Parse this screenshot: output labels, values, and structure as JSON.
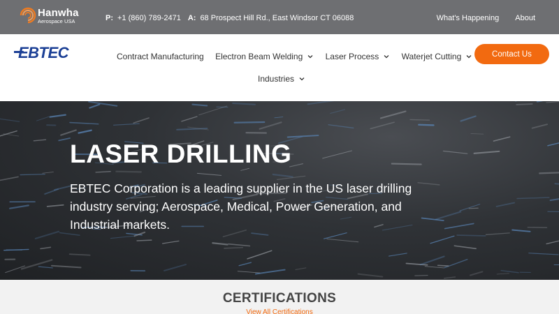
{
  "topbar": {
    "brand_name": "Hanwha",
    "brand_sub": "Aerospace USA",
    "phone_label": "P:",
    "phone": "+1 (860) 789-2471",
    "address_label": "A:",
    "address": "68 Prospect Hill Rd., East Windsor CT 06088",
    "links": [
      "What's Happening",
      "About"
    ]
  },
  "nav": {
    "logo_text": "EBTEC",
    "items": [
      {
        "label": "Contract Manufacturing",
        "dropdown": false
      },
      {
        "label": "Electron Beam Welding",
        "dropdown": true
      },
      {
        "label": "Laser Process",
        "dropdown": true
      },
      {
        "label": "Waterjet Cutting",
        "dropdown": true
      }
    ],
    "industries_label": "Industries",
    "contact_label": "Contact Us"
  },
  "hero": {
    "title": "LASER DRILLING",
    "text": "EBTEC Corporation is a leading supplier in the US laser drilling industry serving; Aerospace, Medical, Power Generation, and Industrial markets."
  },
  "certifications": {
    "title": "CERTIFICATIONS",
    "link": "View All Certifications"
  },
  "colors": {
    "topbar_bg": "#6e6f72",
    "accent_orange": "#f26a10",
    "logo_blue": "#1b3f95"
  },
  "icons": [
    "hanwha-logo-icon",
    "ebtec-logo-icon",
    "chevron-down-icon"
  ]
}
